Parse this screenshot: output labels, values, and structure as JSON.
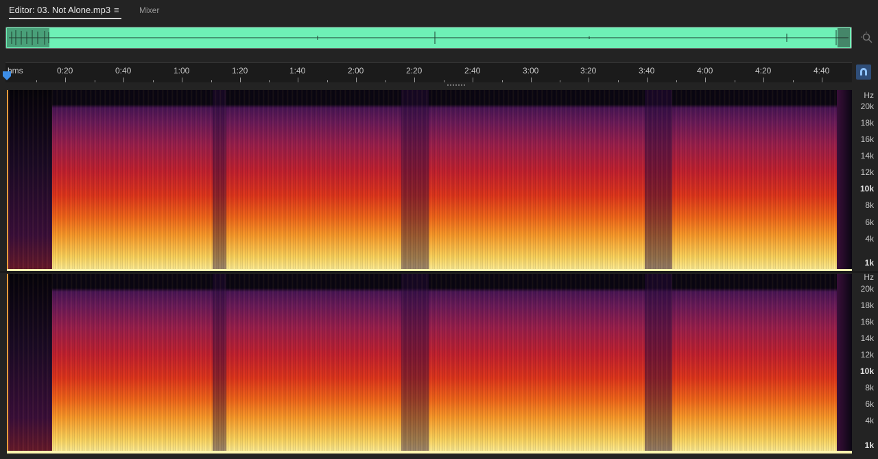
{
  "tabs": {
    "editor_label": "Editor: 03. Not Alone.mp3",
    "menu_glyph": "≡",
    "mixer_label": "Mixer"
  },
  "overview": {
    "waveform_color": "#6ef0b6"
  },
  "timeline": {
    "unit_label": "hms",
    "marks": [
      "0:20",
      "0:40",
      "1:00",
      "1:20",
      "1:40",
      "2:00",
      "2:20",
      "2:40",
      "3:00",
      "3:20",
      "3:40",
      "4:00",
      "4:20",
      "4:40"
    ]
  },
  "frequency_axis": {
    "unit": "Hz",
    "labels": [
      "20k",
      "18k",
      "16k",
      "14k",
      "12k",
      "10k",
      "8k",
      "6k",
      "4k",
      "1k"
    ],
    "bold_labels": [
      "10k",
      "1k"
    ]
  },
  "icons": {
    "menu": "hamburger-icon",
    "zoom": "zoom-to-selection-icon",
    "snap": "magnet-icon",
    "playhead": "playhead-marker-icon"
  },
  "colors": {
    "accent": "#2f4e79",
    "waveform": "#6ef0b6",
    "spectral_high": "#fff2a0",
    "spectral_mid": "#e0341c",
    "spectral_low": "#4a1556"
  }
}
